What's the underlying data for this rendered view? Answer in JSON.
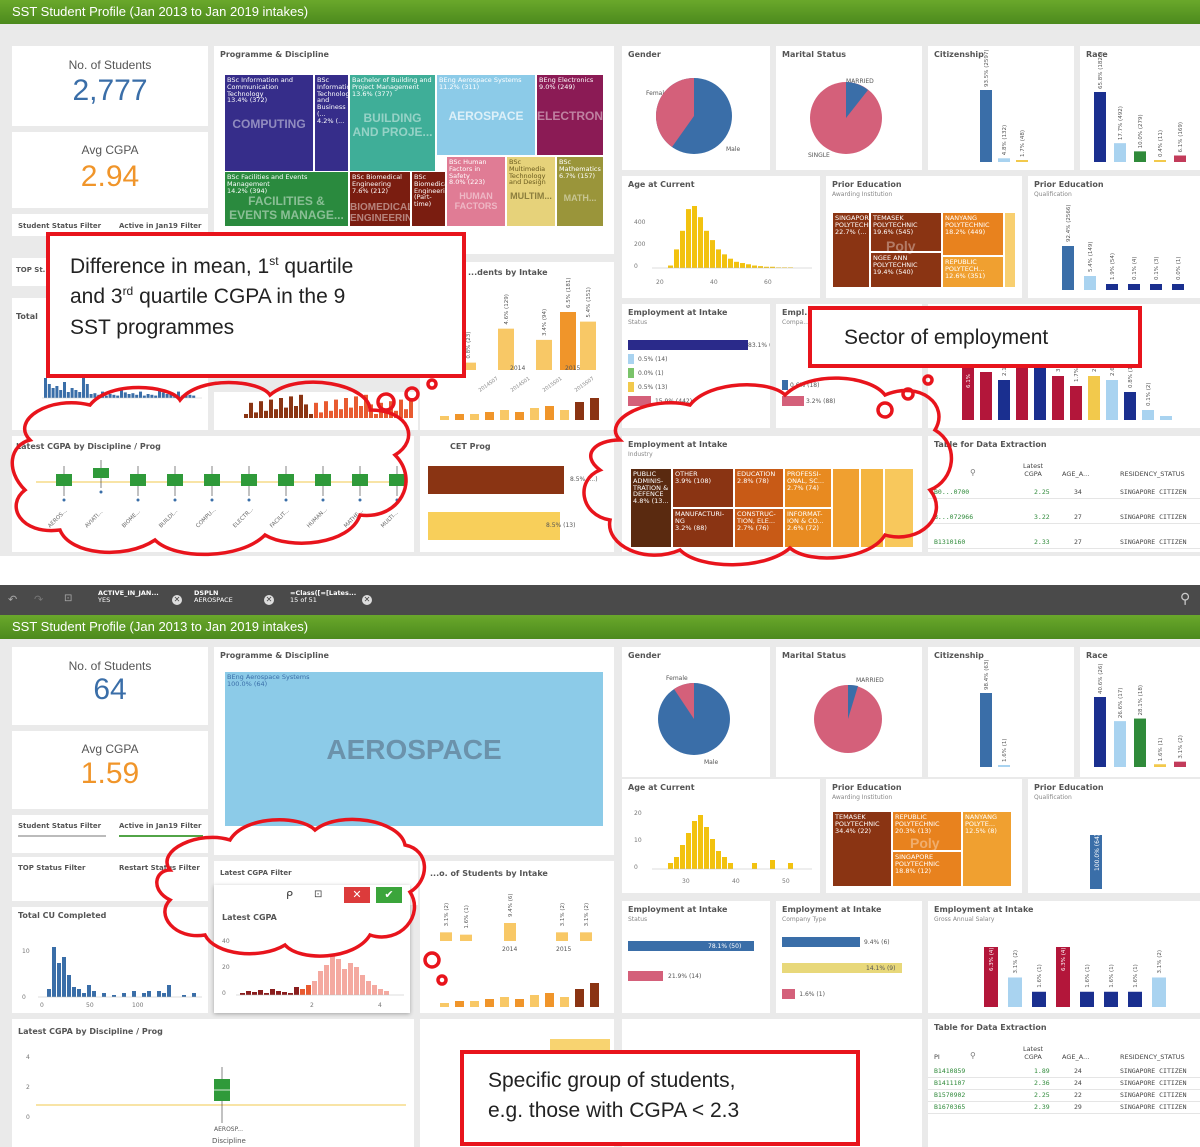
{
  "top": {
    "title": "SST Student Profile (Jan 2013 to Jan 2019 intakes)",
    "kpi_students_label": "No. of Students",
    "kpi_students_value": "2,777",
    "kpi_cgpa_label": "Avg CGPA",
    "kpi_cgpa_value": "2.94",
    "filter_status": "Student Status Filter",
    "filter_active": "Active in Jan19 Filter",
    "programme_title": "Programme & Discipline",
    "tiles": [
      {
        "name": "BSc Information and Communication Technology",
        "pct": "13.4% (372)",
        "big": "COMPUTING"
      },
      {
        "name": "BSc Information Technology and Business (...",
        "pct": "4.2% (..."
      },
      {
        "name": "Bachelor of Building and Project Management",
        "pct": "13.6% (377)",
        "big": "BUILDING AND PROJE..."
      },
      {
        "name": "BEng Aerospace Systems",
        "pct": "11.2% (311)",
        "big": "AEROSPACE"
      },
      {
        "name": "BEng Electronics",
        "pct": "9.0% (249)",
        "big": "ELECTRON..."
      },
      {
        "name": "BSc Facilities and Events Management",
        "pct": "14.2% (394)",
        "big": "FACILITIES & EVENTS MANAGE..."
      },
      {
        "name": "BSc Biomedical Engineering",
        "pct": "7.6% (212)",
        "big": "BIOMEDICAL ENGINEERING"
      },
      {
        "name": "BSc Biomedical Engineering (Part-time)",
        "pct": ""
      },
      {
        "name": "BSc Human Factors in Safety",
        "pct": "8.0% (223)",
        "big": "HUMAN FACTORS"
      },
      {
        "name": "BSc Multimedia Technology and Design",
        "pct": "",
        "big": "MULTIM..."
      },
      {
        "name": "BSc Mathematics",
        "pct": "6.7% (157)",
        "big": "MATH..."
      }
    ],
    "gender_title": "Gender",
    "gender_female": "Female",
    "gender_male": "Male",
    "marital_title": "Marital Status",
    "marital_married": "MARRIED",
    "marital_single": "SINGLE",
    "citizenship_title": "Citizenship",
    "citizenship_bars": [
      {
        "label": "93.5% (2597)",
        "value": 93.5,
        "color": "#3a6ea8"
      },
      {
        "label": "4.8% (132)",
        "value": 4.8,
        "color": "#a9d3f0"
      },
      {
        "label": "1.7% (48)",
        "value": 1.7,
        "color": "#f2c94c"
      }
    ],
    "race_title": "Race",
    "race_bars": [
      {
        "label": "65.8% (1826)",
        "value": 65.8,
        "color": "#1a2f8f"
      },
      {
        "label": "17.7% (492)",
        "value": 17.7,
        "color": "#a9d3f0"
      },
      {
        "label": "10.0% (279)",
        "value": 10.0,
        "color": "#2f8a3a"
      },
      {
        "label": "0.4% (11)",
        "value": 0.4,
        "color": "#f2c94c"
      },
      {
        "label": "6.1% (169)",
        "value": 6.1,
        "color": "#c23b5a"
      }
    ],
    "age_title": "Age at Current",
    "age_ticks": [
      "20",
      "40",
      "60"
    ],
    "age_yticks": [
      "400",
      "200",
      "0"
    ],
    "prior_inst_title": "Prior Education",
    "prior_inst_sub": "Awarding Institution",
    "prior_inst": [
      {
        "name": "SINGAPORE POLYTECHNIC",
        "pct": "22.7% (..."
      },
      {
        "name": "TEMASEK POLYTECHNIC",
        "pct": "19.6% (545)"
      },
      {
        "name": "NGEE ANN POLYTECHNIC",
        "pct": "19.4% (540)"
      },
      {
        "name": "NANYANG POLYTECHNIC",
        "pct": "18.2% (449)"
      },
      {
        "name": "REPUBLIC POLYTECH...",
        "pct": "12.6% (351)"
      }
    ],
    "prior_inst_big": "Poly",
    "prior_qual_title": "Prior Education",
    "prior_qual_sub": "Qualification",
    "prior_qual_bars": [
      "92.4% (2566)",
      "5.4% (149)",
      "1.9% (54)",
      "0.1% (4)",
      "0.1% (3)",
      "0.0% (1)"
    ],
    "top_status": "TOP St...",
    "total_title": "Total",
    "intake_title": "...dents by Intake",
    "intake_bars": [
      {
        "label": "0.8% (23)",
        "value": 23
      },
      {
        "label": "4.6% (129)",
        "value": 129
      },
      {
        "label": "3.4% (94)",
        "value": 94
      },
      {
        "label": "6.5% (181)",
        "value": 181
      },
      {
        "label": "5.4% (151)",
        "value": 151
      }
    ],
    "intake_years": [
      "2014",
      "2015"
    ],
    "intake_terms": [
      "2014S07",
      "2014S01",
      "2015S01",
      "2015S07"
    ],
    "emp_status_title": "Employment at Intake",
    "emp_status_sub": "Status",
    "emp_status_bars": [
      {
        "label": "83.1% (2307)",
        "value": 83.1,
        "color": "#2a2a8a"
      },
      {
        "label": "0.5% (14)",
        "value": 0.5,
        "color": "#a9d3f0"
      },
      {
        "label": "0.0% (1)",
        "value": 0.0,
        "color": "#7ac36a"
      },
      {
        "label": "0.5% (13)",
        "value": 0.5,
        "color": "#f2c94c"
      },
      {
        "label": "15.9% (442)",
        "value": 15.9,
        "color": "#d4607a"
      }
    ],
    "emp_company_title": "Empl...",
    "emp_company_sub": "Compa...",
    "emp_company_bars": [
      "0.6% (18)",
      "3.2% (88)"
    ],
    "salary_bars": [
      "0.8% (21)",
      "2.1% (57)",
      "6.7%",
      "4.7% (131)",
      "3.7% (103)",
      "1.7% (4...",
      "2.7%",
      "2.6% (72)",
      "0.8% (12)",
      "0.1% (2)"
    ],
    "salary_top_label": "6.1%",
    "box_title": "Latest CGPA by Discipline / Prog",
    "box_labels": [
      "AEROS...",
      "AVIATI...",
      "BIOME...",
      "BUILDI...",
      "COMPU...",
      "ELECTR...",
      "FACILIT...",
      "HUMAN...",
      "MATHE...",
      "MULTI..."
    ],
    "cet_title": "CET Prog",
    "cet_bars": [
      "8.5% (...)",
      "8.5% (13)"
    ],
    "industry_title": "Employment at Intake",
    "industry_sub": "Industry",
    "industry": [
      {
        "name": "PUBLIC ADMINIS- TRATION & DEFENCE",
        "pct": "4.8% (13..."
      },
      {
        "name": "OTHER",
        "pct": "3.9% (108)"
      },
      {
        "name": "EDUCATION",
        "pct": "2.8% (78)"
      },
      {
        "name": "PROFESSI- ONAL, SC...",
        "pct": "2.7% (74)"
      },
      {
        "name": "MANUFACTURI- NG",
        "pct": "3.2% (88)"
      },
      {
        "name": "CONSTRUC- TION, ELE...",
        "pct": "2.7% (76)"
      },
      {
        "name": "INFORMAT- ION & CO...",
        "pct": "2.6% (72)"
      }
    ],
    "table_title": "Table for Data Extraction",
    "table_headers": [
      "Latest CGPA",
      "AGE_A...",
      "RESIDENCY_STATUS"
    ],
    "table_rows": [
      {
        "id": "B0...0700",
        "cgpa": "2.25",
        "age": "34",
        "res": "SINGAPORE CITIZEN"
      },
      {
        "id": "B...072966",
        "cgpa": "3.22",
        "age": "27",
        "res": "SINGAPORE CITIZEN"
      },
      {
        "id": "B1310160",
        "cgpa": "2.33",
        "age": "27",
        "res": "SINGAPORE CITIZEN"
      }
    ]
  },
  "selections": [
    {
      "field": "ACTIVE_IN_JAN...",
      "value": "YES"
    },
    {
      "field": "DSPLN",
      "value": "AEROSPACE"
    },
    {
      "field": "=Class([=[Lates...",
      "value": "15 of 51"
    }
  ],
  "bottom": {
    "title": "SST Student Profile (Jan 2013 to Jan 2019 intakes)",
    "kpi_students_label": "No. of Students",
    "kpi_students_value": "64",
    "kpi_cgpa_label": "Avg CGPA",
    "kpi_cgpa_value": "1.59",
    "filter_status": "Student Status Filter",
    "filter_active": "Active in Jan19 Filter",
    "filter_top": "TOP Status Filter",
    "filter_restart": "Restart Status Filter",
    "programme_title": "Programme & Discipline",
    "tile_name": "BEng Aerospace Systems",
    "tile_pct": "100.0% (64)",
    "tile_big": "AEROSPACE",
    "gender_title": "Gender",
    "gender_female": "Female",
    "gender_male": "Male",
    "marital_title": "Marital Status",
    "marital_married": "MARRIED",
    "citizenship_title": "Citizenship",
    "citizenship_bars": [
      {
        "label": "98.4% (63)",
        "value": 98.4
      },
      {
        "label": "1.6% (1)",
        "value": 1.6
      }
    ],
    "race_title": "Race",
    "race_bars": [
      {
        "label": "40.6% (26)",
        "value": 40.6,
        "color": "#1a2f8f"
      },
      {
        "label": "26.6% (17)",
        "value": 26.6,
        "color": "#a9d3f0"
      },
      {
        "label": "28.1% (18)",
        "value": 28.1,
        "color": "#2f8a3a"
      },
      {
        "label": "1.6% (1)",
        "value": 1.6,
        "color": "#f2c94c"
      },
      {
        "label": "3.1% (2)",
        "value": 3.1,
        "color": "#c23b5a"
      }
    ],
    "age_title": "Age at Current",
    "age_ticks": [
      "30",
      "40",
      "50"
    ],
    "age_yticks": [
      "20",
      "10",
      "0"
    ],
    "prior_inst_title": "Prior Education",
    "prior_inst_sub": "Awarding Institution",
    "prior_inst": [
      {
        "name": "TEMASEK POLYTECHNIC",
        "pct": "34.4% (22)"
      },
      {
        "name": "REPUBLIC POLYTECHNIC",
        "pct": "20.3% (13)"
      },
      {
        "name": "NANYANG POLYTE...",
        "pct": "12.5% (8)"
      },
      {
        "name": "SINGAPORE POLYTECHNIC",
        "pct": "18.8% (12)"
      }
    ],
    "prior_inst_big": "Poly",
    "prior_qual_title": "Prior Education",
    "prior_qual_sub": "Qualification",
    "prior_qual_bar": "100.0% (64)",
    "latest_filter": "Latest CGPA Filter",
    "intake_title": "...o. of Students by Intake",
    "intake_bars": [
      {
        "label": "3.1% (2)",
        "value": 2
      },
      {
        "label": "1.6% (1)",
        "value": 1
      },
      {
        "label": "9.4% (6)",
        "value": 6
      },
      {
        "label": "3.1% (2)",
        "value": 2
      },
      {
        "label": "3.1% (2)",
        "value": 2
      }
    ],
    "intake_years": [
      "2014",
      "2015"
    ],
    "total_title": "Total CU Completed",
    "total_yticks": [
      "10",
      "0"
    ],
    "total_xticks": [
      "0",
      "50",
      "100"
    ],
    "popup_title": "Latest CGPA",
    "popup_yticks": [
      "40",
      "20",
      "0"
    ],
    "popup_xticks": [
      "2",
      "4"
    ],
    "emp_status_title": "Employment at Intake",
    "emp_status_sub": "Status",
    "emp_status_bars": [
      {
        "label": "78.1% (50)",
        "value": 78.1,
        "color": "#3a6ea8"
      },
      {
        "label": "21.9% (14)",
        "value": 21.9,
        "color": "#d4607a"
      }
    ],
    "emp_company_title": "Employment at Intake",
    "emp_company_sub": "Company Type",
    "emp_company_bars": [
      {
        "label": "9.4% (6)",
        "value": 9.4,
        "color": "#3a6ea8"
      },
      {
        "label": "14.1% (9)",
        "value": 14.1,
        "color": "#e8d87a"
      },
      {
        "label": "1.6% (1)",
        "value": 1.6,
        "color": "#d4607a"
      }
    ],
    "salary_title": "Employment at Intake",
    "salary_sub": "Gross Annual Salary",
    "salary_bars": [
      {
        "label": "6.3% (4)",
        "value": 6.3,
        "color": "#b3163a"
      },
      {
        "label": "3.1% (2)",
        "value": 3.1,
        "color": "#a9d3f0"
      },
      {
        "label": "1.6% (1)",
        "value": 1.6,
        "color": "#1a2f8f"
      },
      {
        "label": "6.3% (4)",
        "value": 6.3,
        "color": "#b3163a"
      },
      {
        "label": "1.6% (1)",
        "value": 1.6,
        "color": "#1a2f8f"
      },
      {
        "label": "1.6% (1)",
        "value": 1.6,
        "color": "#1a2f8f"
      },
      {
        "label": "1.6% (1)",
        "value": 1.6,
        "color": "#1a2f8f"
      },
      {
        "label": "3.1% (2)",
        "value": 3.1,
        "color": "#a9d3f0"
      }
    ],
    "box_title": "Latest CGPA by Discipline / Prog",
    "box_yticks": [
      "4",
      "2",
      "0"
    ],
    "box_label": "AEROSP...",
    "box_xlabel": "Discipline",
    "table_title": "Table for Data Extraction",
    "table_headers": [
      "PI",
      "Latest CGPA",
      "AGE_A...",
      "RESIDENCY_STATUS"
    ],
    "table_rows": [
      {
        "id": "B1410859",
        "cgpa": "1.89",
        "age": "24",
        "res": "SINGAPORE CITIZEN"
      },
      {
        "id": "B1411107",
        "cgpa": "2.36",
        "age": "24",
        "res": "SINGAPORE CITIZEN"
      },
      {
        "id": "B1570902",
        "cgpa": "2.25",
        "age": "22",
        "res": "SINGAPORE CITIZEN"
      },
      {
        "id": "B1670365",
        "cgpa": "2.39",
        "age": "29",
        "res": "SINGAPORE CITIZEN"
      }
    ]
  },
  "callouts": {
    "c1_line1": "Difference in mean, 1",
    "c1_sup1": "st",
    "c1_line1b": " quartile",
    "c1_line2": "and 3",
    "c1_sup2": "rd",
    "c1_line2b": " quartile CGPA in the 9",
    "c1_line3": "SST programmes",
    "c2": "Sector of employment",
    "c3_line1": "Specific group of students,",
    "c3_line2": "e.g. those with CGPA < 2.3"
  },
  "colors": {
    "green_title": "#5a9a25",
    "highlight_red": "#e8141c",
    "kpi_blue": "#3a6ea8",
    "kpi_orange": "#f0952a"
  }
}
